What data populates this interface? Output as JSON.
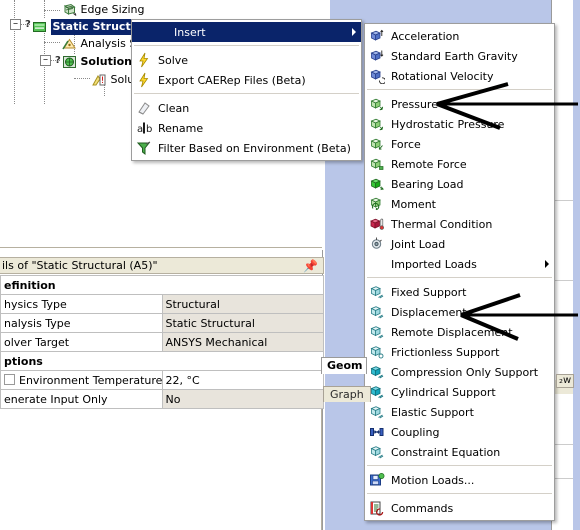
{
  "app": {
    "accent_highlight": "#0a246a",
    "background_blue": "#b9c6e8",
    "panel_gray": "#ece9d8",
    "value_cell_gray": "#e8e4dc"
  },
  "tree": {
    "items": [
      {
        "label": "Edge Sizing",
        "icon": "mesh-sizing-icon",
        "bold": false,
        "selected": false,
        "depth": 3
      },
      {
        "label": "Static Structural",
        "icon": "environment-folder-icon",
        "bold": true,
        "selected": true,
        "depth": 1
      },
      {
        "label": "Analysis S",
        "icon": "analysis-settings-icon",
        "bold": false,
        "selected": false,
        "depth": 2
      },
      {
        "label": "Solution",
        "icon": "solution-icon",
        "bold": true,
        "selected": false,
        "depth": 2
      },
      {
        "label": "Solu",
        "icon": "solution-information-icon",
        "bold": false,
        "selected": false,
        "depth": 3
      }
    ],
    "selected_suffix": "(A5)",
    "query_marker": "?"
  },
  "context_menu": {
    "items": [
      {
        "label": "Insert",
        "icon": "none",
        "highlighted": true,
        "submenu": true,
        "separator_after": true
      },
      {
        "label": "Solve",
        "icon": "lightning-icon",
        "highlighted": false,
        "submenu": false,
        "separator_after": false
      },
      {
        "label": "Export CAERep Files (Beta)",
        "icon": "lightning-icon",
        "highlighted": false,
        "submenu": false,
        "separator_after": true
      },
      {
        "label": "Clean",
        "icon": "eraser-icon",
        "highlighted": false,
        "submenu": false,
        "separator_after": false
      },
      {
        "label": "Rename",
        "icon": "rename-abc-icon",
        "highlighted": false,
        "submenu": false,
        "separator_after": false
      },
      {
        "label": "Filter Based on Environment (Beta)",
        "icon": "funnel-icon",
        "highlighted": false,
        "submenu": false,
        "separator_after": false
      }
    ]
  },
  "insert_submenu": {
    "items": [
      {
        "label": "Acceleration",
        "icon": "blue-cube-up-icon",
        "submenu": false,
        "separator_after": false
      },
      {
        "label": "Standard Earth Gravity",
        "icon": "blue-cube-down-icon",
        "submenu": false,
        "separator_after": false
      },
      {
        "label": "Rotational Velocity",
        "icon": "blue-cube-rotate-icon",
        "submenu": false,
        "separator_after": true
      },
      {
        "label": "Pressure",
        "icon": "green-cube-pressure-icon",
        "submenu": false,
        "separator_after": false
      },
      {
        "label": "Hydrostatic Pressure",
        "icon": "green-cube-hydrostatic-icon",
        "submenu": false,
        "separator_after": false
      },
      {
        "label": "Force",
        "icon": "green-cube-force-icon",
        "submenu": false,
        "separator_after": false
      },
      {
        "label": "Remote Force",
        "icon": "green-cube-remote-icon",
        "submenu": false,
        "separator_after": false
      },
      {
        "label": "Bearing Load",
        "icon": "green-solid-bearing-icon",
        "submenu": false,
        "separator_after": false
      },
      {
        "label": "Moment",
        "icon": "green-cube-moment-icon",
        "submenu": false,
        "separator_after": false
      },
      {
        "label": "Thermal Condition",
        "icon": "red-thermal-icon",
        "submenu": false,
        "separator_after": false
      },
      {
        "label": "Joint Load",
        "icon": "joint-load-icon",
        "submenu": false,
        "separator_after": false
      },
      {
        "label": "Imported Loads",
        "icon": "none",
        "submenu": true,
        "separator_after": true
      },
      {
        "label": "Fixed Support",
        "icon": "cyan-cube-fixed-icon",
        "submenu": false,
        "separator_after": false
      },
      {
        "label": "Displacement",
        "icon": "cyan-cube-displacement-icon",
        "submenu": false,
        "separator_after": false
      },
      {
        "label": "Remote Displacement",
        "icon": "cyan-cube-remote-disp-icon",
        "submenu": false,
        "separator_after": false
      },
      {
        "label": "Frictionless Support",
        "icon": "cyan-cube-frictionless-icon",
        "submenu": false,
        "separator_after": false
      },
      {
        "label": "Compression Only Support",
        "icon": "teal-cube-compression-icon",
        "submenu": false,
        "separator_after": false
      },
      {
        "label": "Cylindrical Support",
        "icon": "teal-cube-cylindrical-icon",
        "submenu": false,
        "separator_after": false
      },
      {
        "label": "Elastic Support",
        "icon": "cyan-cube-elastic-icon",
        "submenu": false,
        "separator_after": false
      },
      {
        "label": "Coupling",
        "icon": "coupling-icon",
        "submenu": false,
        "separator_after": false
      },
      {
        "label": "Constraint Equation",
        "icon": "cyan-cube-constraint-icon",
        "submenu": false,
        "separator_after": true
      },
      {
        "label": "Motion Loads...",
        "icon": "motion-loads-disk-icon",
        "submenu": false,
        "separator_after": true
      },
      {
        "label": "Commands",
        "icon": "commands-icon",
        "submenu": false,
        "separator_after": false
      }
    ]
  },
  "details": {
    "title": "ils of \"Static Structural (A5)\"",
    "pin_icon": "pin-icon",
    "rows": [
      {
        "type": "section",
        "label": "efinition"
      },
      {
        "type": "prop",
        "label": "hysics Type",
        "value": "Structural",
        "checkbox": false
      },
      {
        "type": "prop",
        "label": "nalysis Type",
        "value": "Static Structural",
        "checkbox": false
      },
      {
        "type": "prop",
        "label": "olver Target",
        "value": "ANSYS Mechanical",
        "checkbox": false
      },
      {
        "type": "section",
        "label": "ptions"
      },
      {
        "type": "prop",
        "label": "Environment Temperature",
        "value": "22, °C",
        "checkbox": true
      },
      {
        "type": "prop",
        "label": "enerate Input Only",
        "value": "No",
        "checkbox": false
      }
    ]
  },
  "tabs": {
    "geometry": "Geom",
    "graph": "Graph",
    "worksheet": "₂w"
  },
  "annotations": {
    "arrow_pressure_target": "Pressure",
    "arrow_displacement_target": "Displacement"
  }
}
